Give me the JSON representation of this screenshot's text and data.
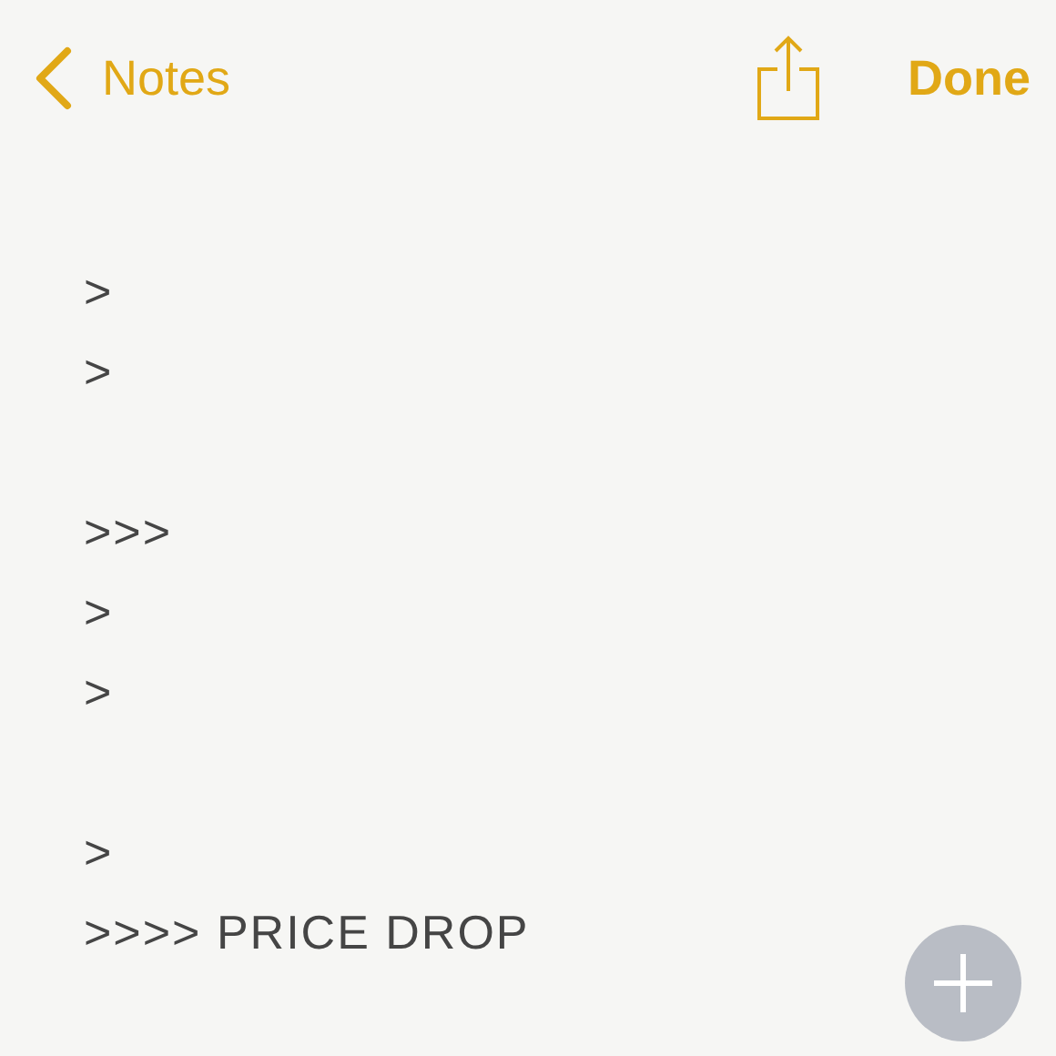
{
  "nav": {
    "back_label": "Notes",
    "done_label": "Done"
  },
  "note": {
    "paragraphs": [
      [
        ">",
        ">"
      ],
      [
        ">>>",
        ">",
        ">"
      ],
      [
        ">",
        ">>>> PRICE DROP"
      ]
    ]
  }
}
